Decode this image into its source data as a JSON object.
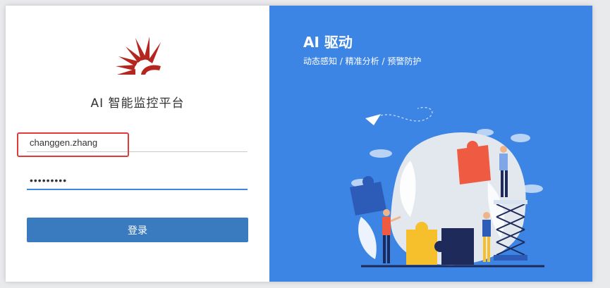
{
  "app": {
    "title": "AI 智能监控平台"
  },
  "login": {
    "username_value": "changgen.zhang",
    "password_value": "•••••••••",
    "submit_label": "登录"
  },
  "hero": {
    "title": "AI 驱动",
    "subtitle": "动态感知 / 精准分析 / 预警防护"
  },
  "colors": {
    "brand_red": "#b5261e",
    "panel_blue": "#3d85e4",
    "button_blue": "#3a7bbf",
    "highlight_red": "#e03b3b"
  },
  "icons": {
    "logo": "sunburst-logo-icon",
    "illustration": "puzzle-teamwork-illustration"
  }
}
